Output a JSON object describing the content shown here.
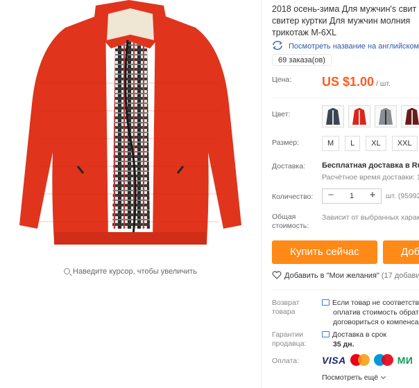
{
  "product": {
    "title_lines": [
      "2018 осень-зима Для мужчин's свит",
      "свитер куртки Для мужчин молния",
      "трикотаж M-6XL"
    ],
    "translate_link": "Посмотреть название на английском",
    "orders": "69 заказа(ов)",
    "main_color": "#e0341c"
  },
  "gallery": {
    "zoom_hint": "Наведите курсор, чтобы увеличить"
  },
  "price": {
    "label": "Цена:",
    "value": "US $1.00",
    "unit": "/ шт.",
    "color": "#ff5a1f"
  },
  "color": {
    "label": "Цвет:",
    "swatch_colors": [
      "#3b4654",
      "#d9261c",
      "#8a8f94",
      "#6b1a1a"
    ]
  },
  "size": {
    "label": "Размер:",
    "options": [
      "M",
      "L",
      "XL",
      "XXL"
    ]
  },
  "delivery": {
    "label": "Доставка:",
    "main": "Бесплатная доставка в Russ",
    "sub": "Расчётное время доставки: 1"
  },
  "quantity": {
    "label": "Количество:",
    "minus": "−",
    "value": "1",
    "plus": "+",
    "unit": "шт. (95992"
  },
  "total": {
    "label_lines": [
      "Общая",
      "стоимость:"
    ],
    "value": "Зависит от выбранных харак"
  },
  "actions": {
    "buy_now": "Купить сейчас",
    "add_to_cart": "Доба",
    "button_color": "#ff8a18"
  },
  "wishlist": {
    "label": "Добавить в \"Мои желания\"",
    "count": "(17 добавили"
  },
  "returns": {
    "label_lines": [
      "Возврат",
      "товара"
    ],
    "text_lines": [
      "Если товар не соответству",
      "оплатив стоимость обрат",
      "договориться о компенса"
    ]
  },
  "guarantee": {
    "label_lines": [
      "Гарантии",
      "продавца:"
    ],
    "line1": "Доставка в срок",
    "line2": "35 дн."
  },
  "payment": {
    "label": "Оплата:",
    "visa": "VISA",
    "mir": "МИ",
    "more": "Посмотреть ещё"
  }
}
